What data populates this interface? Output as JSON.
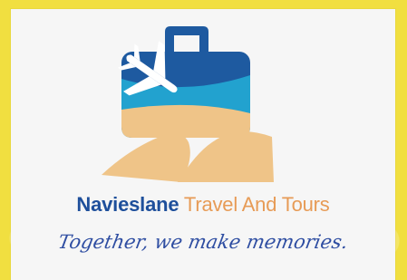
{
  "brand": {
    "name": "Navieslane",
    "rest": " Travel And Tours"
  },
  "tagline": "Together, we make memories.",
  "icons": {
    "logo": "suitcase-with-airplane-logo",
    "plane": "airplane-icon"
  },
  "colors": {
    "background": "#f1df40",
    "card": "#f6f6f6",
    "suitcase": "#1e5aa0",
    "ocean": "#22a2cf",
    "sand": "#efc488",
    "brand_blue": "#1e4f9b",
    "brand_orange": "#e79b56"
  }
}
